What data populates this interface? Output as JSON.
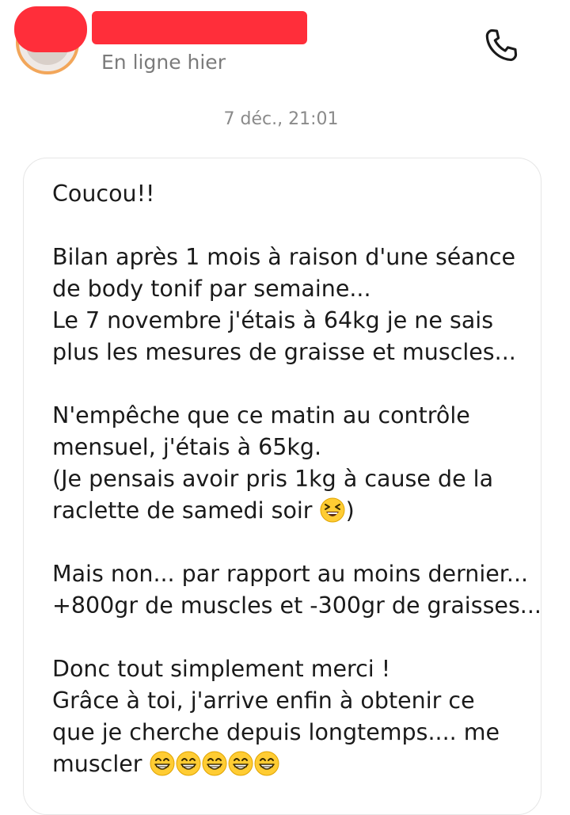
{
  "header": {
    "status": "En ligne hier",
    "call_icon": "phone-icon"
  },
  "conversation": {
    "timestamp": "7 déc., 21:01"
  },
  "message": {
    "lines": [
      "Coucou!!",
      "Bilan après 1 mois à raison d'une séance",
      "de body tonif par semaine...",
      "Le 7 novembre j'étais à 64kg je ne sais",
      "plus les mesures de graisse et muscles...",
      "N'empêche que ce matin au contrôle",
      "mensuel, j'étais à 65kg.",
      "(Je pensais avoir pris 1kg à cause de la",
      "raclette de samedi soir ",
      ")",
      "Mais non... par rapport au moins dernier...",
      "+800gr de muscles et -300gr de graisses...",
      "Donc tout simplement merci !",
      "Grâce à toi, j'arrive enfin à obtenir ce",
      "que je cherche depuis longtemps.... me",
      "muscler "
    ],
    "emojis": {
      "laugh": "grinning-squinting-face-icon",
      "grin": "beaming-face-icon"
    }
  },
  "colors": {
    "redaction": "#ff2e3a",
    "avatar_ring": "#f2a65a",
    "status_text": "#7b7b7b",
    "bubble_border": "#e6e6e6"
  }
}
